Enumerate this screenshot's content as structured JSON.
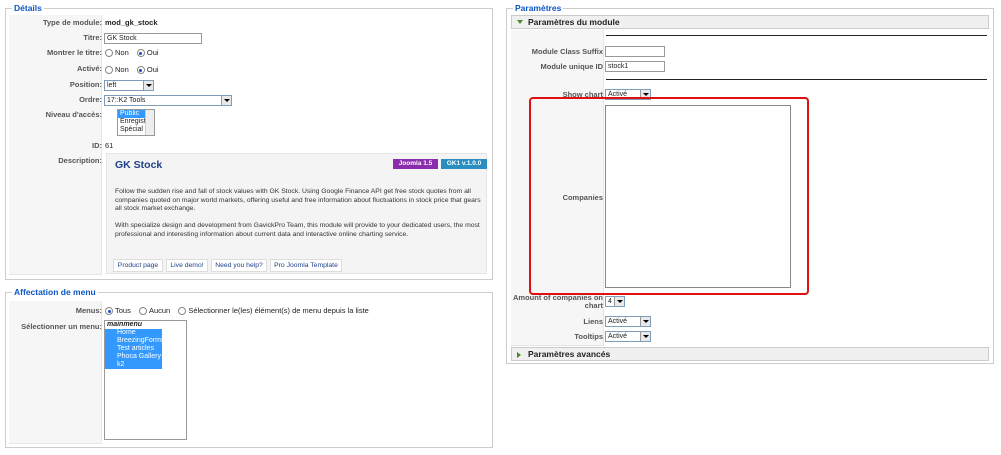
{
  "details": {
    "legend": "Détails",
    "type_label": "Type de module:",
    "type_value": "mod_gk_stock",
    "title_label": "Titre:",
    "title_value": "GK Stock",
    "show_title_label": "Montrer le titre:",
    "enabled_label": "Activé:",
    "no_label": "Non",
    "yes_label": "Oui",
    "position_label": "Position:",
    "position_value": "left",
    "order_label": "Ordre:",
    "order_value": "17::K2 Tools",
    "access_label": "Niveau d'accès:",
    "access_options": [
      "Public",
      "Enregistré",
      "Spécial"
    ],
    "id_label": "ID:",
    "id_value": "61",
    "description_label": "Description:"
  },
  "description": {
    "title": "GK Stock",
    "badge_joomla": "Joomla 1.5",
    "badge_version": "GK1 v.1.0.0",
    "para1_line1": "Follow the sudden rise and fall of stock values with GK Stock. Using Google Finance API get free stock quotes from all",
    "para1_line2": "companies quoted on major world markets, offering useful and free information about fluctuations in stock price that gears",
    "para1_line3": "all stock market exchange.",
    "para2_line1": "With specialize design and development from GavickPro Team, this module will provide to your dedicated users, the most",
    "para2_line2": "professional and interesting information about current data and interactive online charting service.",
    "links": [
      "Product page",
      "Live demo!",
      "Need you help?",
      "Pro Joomla Template"
    ],
    "colors": {
      "joomla": "#8b2eae",
      "version": "#2a8fc0",
      "title": "#1e3f8a"
    }
  },
  "menu_assignment": {
    "legend": "Affectation de menu",
    "menus_label": "Menus:",
    "opt_all": "Tous",
    "opt_none": "Aucun",
    "opt_select": "Sélectionner le(les) élément(s) de menu depuis la liste",
    "select_label": "Sélectionner un menu:",
    "list_header": "mainmenu",
    "list_items": [
      "Home",
      "BreezingForms",
      "Test articles",
      "Phoca Gallery",
      "k2"
    ]
  },
  "parameters": {
    "legend": "Paramètres",
    "module_params": "Paramètres du module",
    "class_suffix_label": "Module Class Suffix",
    "class_suffix_value": "",
    "unique_id_label": "Module unique ID",
    "unique_id_value": "stock1",
    "show_chart_label": "Show chart",
    "show_chart_value": "Activé",
    "companies_label": "Companies",
    "amount_label_1": "Amount of companies on",
    "amount_label_2": "chart",
    "amount_value": "4",
    "links_label": "Liens",
    "links_value": "Activé",
    "tooltips_label": "Tooltips",
    "tooltips_value": "Activé",
    "advanced_params": "Paramètres avancés",
    "highlight_color": "#e01010"
  }
}
